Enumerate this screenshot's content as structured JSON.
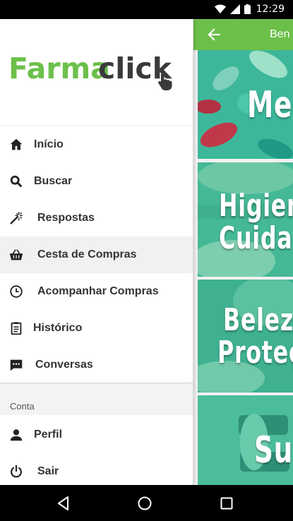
{
  "status_bar": {
    "time": "12:29",
    "icons": [
      "wifi-icon",
      "signal-icon",
      "battery-icon"
    ]
  },
  "app_bar": {
    "title": "Ben",
    "back_icon": "arrow-left-icon",
    "color": "#6cc04a"
  },
  "logo": {
    "part1": "Farma",
    "part2": "click"
  },
  "menu": [
    {
      "label": "Início",
      "icon": "home-icon"
    },
    {
      "label": "Buscar",
      "icon": "search-icon"
    },
    {
      "label": "Respostas",
      "icon": "magic-wand-icon"
    },
    {
      "label": "Cesta de Compras",
      "icon": "basket-icon",
      "selected": true
    },
    {
      "label": "Acompanhar Compras",
      "icon": "clock-icon"
    },
    {
      "label": "Histórico",
      "icon": "clipboard-icon"
    },
    {
      "label": "Conversas",
      "icon": "chat-icon"
    }
  ],
  "account_section": {
    "title": "Conta",
    "items": [
      {
        "label": "Perfil",
        "icon": "person-icon"
      },
      {
        "label": "Sair",
        "icon": "power-icon"
      }
    ]
  },
  "categories": [
    {
      "line1": "Med",
      "line2": ""
    },
    {
      "line1": "Higiene",
      "line2": "Cuidad"
    },
    {
      "line1": "Beleza",
      "line2": "Proteç"
    },
    {
      "line1": "Su",
      "line2": ""
    }
  ],
  "nav_bar": {
    "icons": [
      "back-nav-icon",
      "home-nav-icon",
      "recents-nav-icon"
    ]
  }
}
